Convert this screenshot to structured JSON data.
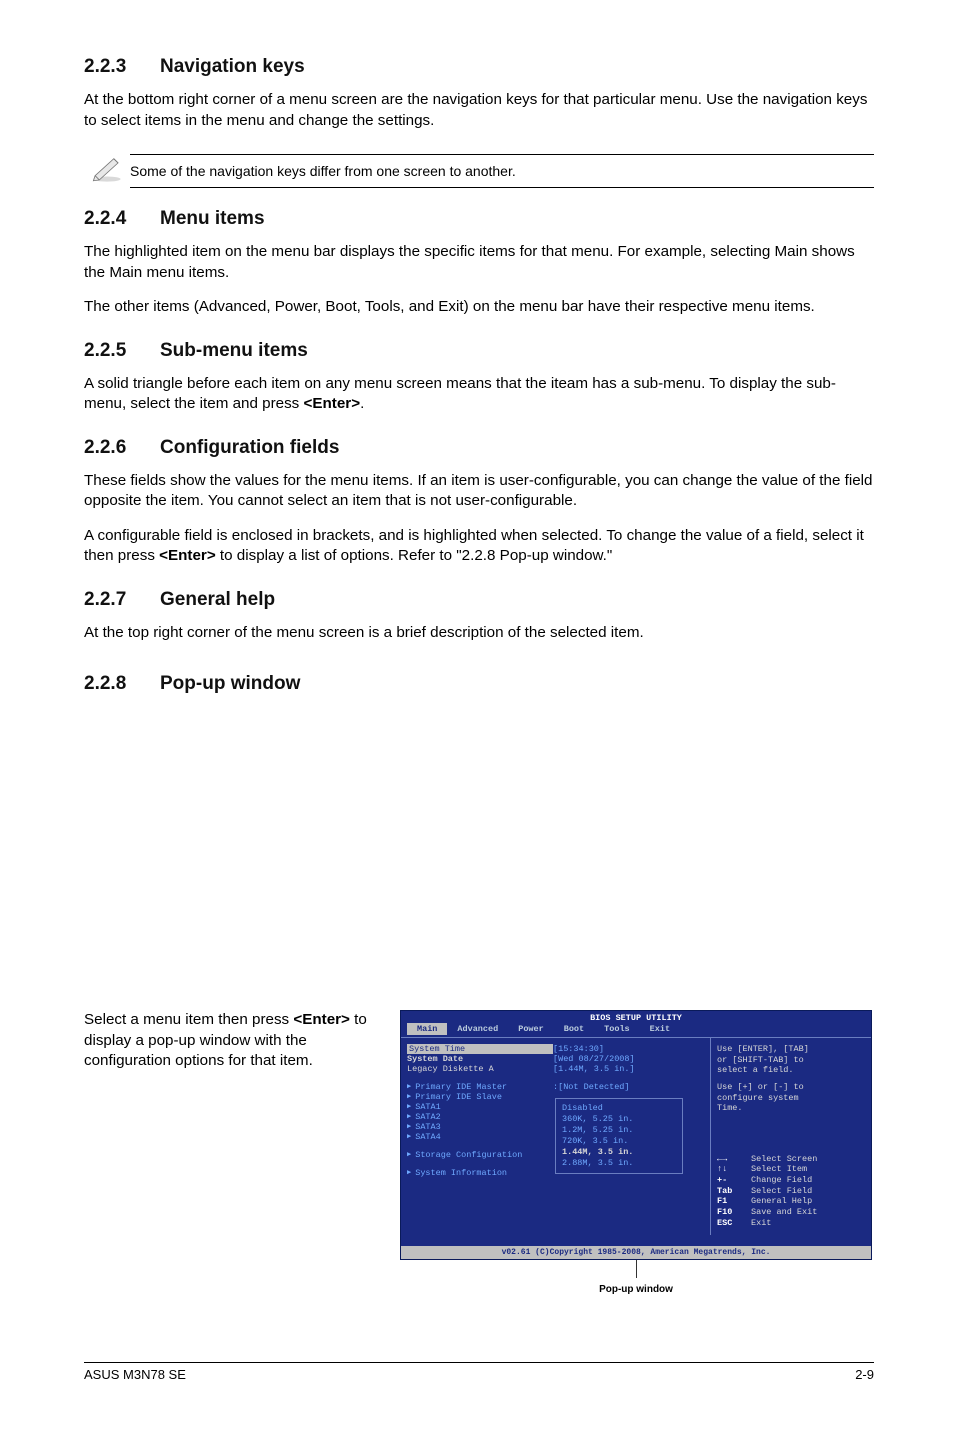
{
  "sections": {
    "s223": {
      "num": "2.2.3",
      "title": "Navigation keys",
      "p1": "At the bottom right corner of a menu screen are the navigation keys for that particular menu. Use the navigation keys to select items in the menu and change the settings."
    },
    "note": "Some of the navigation keys differ from one screen to another.",
    "s224": {
      "num": "2.2.4",
      "title": "Menu items",
      "p1": "The highlighted item on the menu bar  displays the specific items for that menu. For example, selecting Main shows the Main menu items.",
      "p2": "The other items (Advanced, Power, Boot, Tools, and Exit) on the menu bar have their respective menu items."
    },
    "s225": {
      "num": "2.2.5",
      "title": "Sub-menu items",
      "p1_a": "A solid triangle before each item on any menu screen means that the iteam has a sub-menu. To display the sub-menu, select the item and press ",
      "p1_b": "<Enter>",
      "p1_c": "."
    },
    "s226": {
      "num": "2.2.6",
      "title": "Configuration fields",
      "p1": "These fields show the values for the menu items. If an item is user-configurable, you can change the value of the field opposite the item. You cannot select an item that is not user-configurable.",
      "p2_a": "A configurable field is enclosed in brackets, and is highlighted when selected. To change the value of a field, select it then press ",
      "p2_b": "<Enter>",
      "p2_c": " to display a list of options. Refer to \"2.2.8 Pop-up window.\""
    },
    "s227": {
      "num": "2.2.7",
      "title": "General help",
      "p1": "At the top right corner of the menu screen is a brief description of the selected item."
    },
    "s228": {
      "num": "2.2.8",
      "title": "Pop-up window",
      "p1_a": "Select a menu item then press ",
      "p1_b": "<Enter>",
      "p1_c": " to display a pop-up window with the configuration options for that item."
    }
  },
  "bios": {
    "title": "BIOS SETUP UTILITY",
    "tabs": [
      "Main",
      "Advanced",
      "Power",
      "Boot",
      "Tools",
      "Exit"
    ],
    "rows": {
      "time_l": "System Time",
      "time_v": "[15:34:30]",
      "date_l": "System Date",
      "date_v": "[Wed 08/27/2008]",
      "leg_l": "Legacy Diskette A",
      "leg_v": "[1.44M, 3.5 in.]",
      "pm_l": "Primary IDE Master",
      "pm_v": ":[Not Detected]",
      "ps_l": "Primary IDE Slave",
      "s1": "SATA1",
      "s2": "SATA2",
      "s3": "SATA3",
      "s4": "SATA4",
      "stor": "Storage Configuration",
      "sys": "System Information"
    },
    "popup": {
      "o1": "Disabled",
      "o2": "360K, 5.25 in.",
      "o3": "1.2M, 5.25 in.",
      "o4": "720K, 3.5 in.",
      "o5": "1.44M, 3.5 in.",
      "o6": "2.88M, 3.5 in."
    },
    "help": {
      "l1": "Use [ENTER], [TAB]",
      "l2": "or [SHIFT-TAB] to",
      "l3": "select a field.",
      "l4": "Use [+] or [-] to",
      "l5": "configure system",
      "l6": "Time."
    },
    "legend": {
      "r1k": "←→",
      "r1v": "Select Screen",
      "r2k": "↑↓",
      "r2v": "Select Item",
      "r3k": "+-",
      "r3v": "Change Field",
      "r4k": "Tab",
      "r4v": "Select Field",
      "r5k": "F1",
      "r5v": "General Help",
      "r6k": "F10",
      "r6v": "Save and Exit",
      "r7k": "ESC",
      "r7v": "Exit"
    },
    "footer": "v02.61 (C)Copyright 1985-2008, American Megatrends, Inc.",
    "caption": "Pop-up window"
  },
  "pagefoot": {
    "left": "ASUS M3N78 SE",
    "right": "2-9"
  }
}
